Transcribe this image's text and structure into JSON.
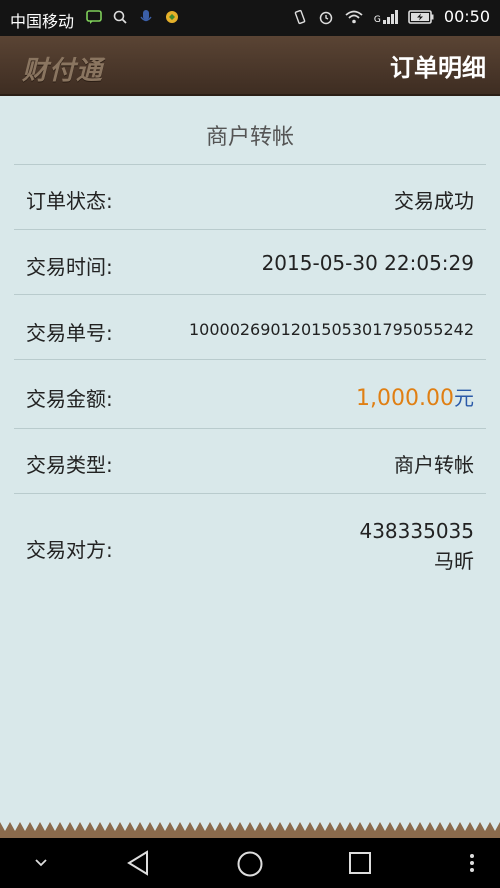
{
  "status_bar": {
    "carrier": "中国移动",
    "time": "00:50",
    "network": "G"
  },
  "header": {
    "logo_text": "财付通",
    "title": "订单明细"
  },
  "order": {
    "section_title": "商户转帐",
    "rows": [
      {
        "label": "订单状态:",
        "value": "交易成功"
      },
      {
        "label": "交易时间:",
        "value": "2015-05-30 22:05:29"
      },
      {
        "label": "交易单号:",
        "value": "1000026901201505301795055242"
      },
      {
        "label": "交易金额:",
        "value": "1,000.00",
        "unit": "元"
      },
      {
        "label": "交易类型:",
        "value": "商户转帐"
      },
      {
        "label": "交易对方:",
        "value": "438335035",
        "value2": "马昕"
      }
    ]
  },
  "colors": {
    "background": "#d9e8ea",
    "header": "#4a3628",
    "amount": "#e07f13",
    "unit": "#2a59a8"
  }
}
